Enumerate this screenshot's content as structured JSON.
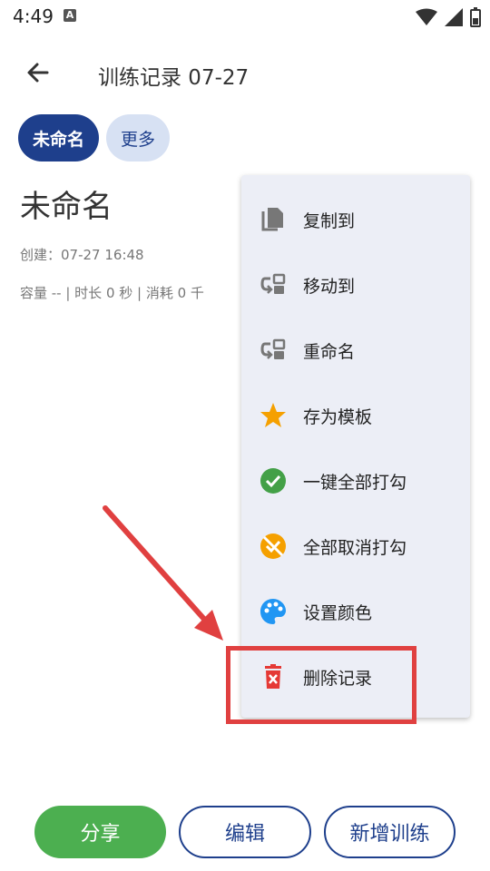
{
  "status_bar": {
    "time": "4:49",
    "badge": "A"
  },
  "header": {
    "title": "训练记录 07-27"
  },
  "chips": [
    {
      "label": "未命名"
    },
    {
      "label": "更多"
    }
  ],
  "record": {
    "name": "未命名",
    "created": "创建：07-27 16:48",
    "stats": "容量 --  |  时长 0 秒  |  消耗 0 千"
  },
  "menu": {
    "items": [
      {
        "label": "复制到",
        "icon": "copy-icon"
      },
      {
        "label": "移动到",
        "icon": "move-icon"
      },
      {
        "label": "重命名",
        "icon": "rename-icon"
      },
      {
        "label": "存为模板",
        "icon": "star-icon"
      },
      {
        "label": "一键全部打勾",
        "icon": "check-circle-icon"
      },
      {
        "label": "全部取消打勾",
        "icon": "uncheck-icon"
      },
      {
        "label": "设置颜色",
        "icon": "palette-icon"
      },
      {
        "label": "删除记录",
        "icon": "delete-icon"
      }
    ]
  },
  "bottom": {
    "share": "分享",
    "edit": "编辑",
    "add": "新增训练"
  },
  "colors": {
    "primary": "#1e3f8c",
    "chip_secondary": "#d7e1f3",
    "green": "#4caf50",
    "orange": "#f5a000",
    "red": "#e04040",
    "blue": "#2196f3",
    "menu_bg": "#eceef6"
  }
}
